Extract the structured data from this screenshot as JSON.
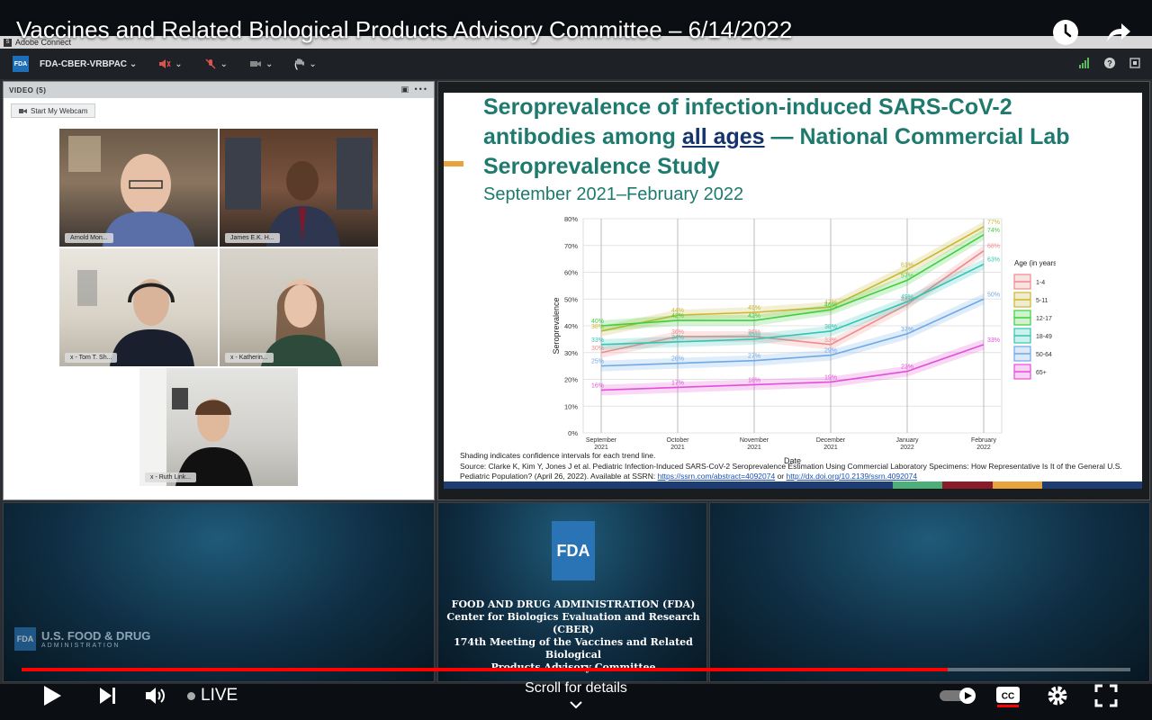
{
  "video": {
    "title": "Vaccines and Related Biological Products Advisory Committee – 6/14/2022",
    "live_label": "LIVE",
    "scroll_hint": "Scroll for details",
    "progress_fraction": 0.835
  },
  "window": {
    "app_title": "Adobe Connect"
  },
  "toolbar": {
    "badge": "FDA",
    "room_name": "FDA-CBER-VRBPAC"
  },
  "video_pod": {
    "header": "VIDEO (5)",
    "webcam_button": "Start My Webcam",
    "participants": [
      {
        "label": "Arnold Mon..."
      },
      {
        "label": "James E.K. H..."
      },
      {
        "label": "x - Tom T. Sh..."
      },
      {
        "label": "x - Katherin..."
      },
      {
        "label": "x - Ruth Link..."
      }
    ]
  },
  "slide": {
    "title_part1": "Seroprevalence of infection-induced SARS-CoV-2 antibodies among ",
    "title_emph": "all ages",
    "title_part2": " — National Commercial Lab Seroprevalence Study",
    "subtitle": "September 2021–February 2022",
    "note_shading": "Shading indicates confidence intervals for each trend line.",
    "note_source": "Source: Clarke K, Kim Y, Jones J et al.  Pediatric Infection-Induced SARS-CoV-2 Seroprevalence Estimation Using Commercial Laboratory Specimens: How Representative Is It of the General U.S. Pediatric Population? (April 26, 2022). Available at SSRN: ",
    "link1": "https://ssrn.com/abstract=4092074",
    "or": " or ",
    "link2": "http://dx.doi.org/10.2139/ssrn.4092074",
    "footer_colors": [
      "#1d3c73",
      "#1d3c73",
      "#1d3c73",
      "#1d3c73",
      "#1d3c73",
      "#1d3c73",
      "#1d3c73",
      "#1d3c73",
      "#1d3c73",
      "#4caf79",
      "#8b1a2b",
      "#e8a33d",
      "#1d3c73",
      "#1d3c73"
    ]
  },
  "chart_data": {
    "type": "line",
    "xlabel": "Date",
    "ylabel": "Seroprevalence",
    "legend_title": "Age (in years)",
    "categories": [
      "September\n2021",
      "October\n2021",
      "November\n2021",
      "December\n2021",
      "January\n2022",
      "February\n2022"
    ],
    "yticks": [
      "0%",
      "10%",
      "20%",
      "30%",
      "40%",
      "50%",
      "60%",
      "70%",
      "80%"
    ],
    "ylim": [
      0,
      80
    ],
    "series": [
      {
        "name": "1-4",
        "color": "#f08a8a",
        "values": [
          30,
          36,
          36,
          33,
          48,
          68
        ],
        "labels": [
          "30%",
          "36%",
          "36%",
          "33%",
          "48%",
          "68%"
        ]
      },
      {
        "name": "5-11",
        "color": "#c9b832",
        "values": [
          38,
          44,
          45,
          47,
          61,
          77
        ],
        "labels": [
          "38%",
          "44%",
          "45%",
          "47%",
          "61%",
          "77%"
        ]
      },
      {
        "name": "12-17",
        "color": "#3fcf3f",
        "values": [
          40,
          42,
          42,
          46,
          57,
          74
        ],
        "labels": [
          "40%",
          "42%",
          "42%",
          "46%",
          "57%",
          "74%"
        ]
      },
      {
        "name": "18-49",
        "color": "#33c4b4",
        "values": [
          33,
          34,
          35,
          38,
          49,
          63
        ],
        "labels": [
          "33%",
          "34%",
          "35%",
          "38%",
          "49%",
          "63%"
        ]
      },
      {
        "name": "50-64",
        "color": "#6fa8e6",
        "values": [
          25,
          26,
          27,
          29,
          37,
          50
        ],
        "labels": [
          "25%",
          "26%",
          "27%",
          "29%",
          "37%",
          "50%"
        ]
      },
      {
        "name": "65+",
        "color": "#e34fd8",
        "values": [
          16,
          17,
          18,
          19,
          23,
          33
        ],
        "labels": [
          "16%",
          "17%",
          "18%",
          "19%",
          "23%",
          "33%"
        ]
      }
    ]
  },
  "lower": {
    "fda_logo": "FDA",
    "info_lines": [
      "FOOD AND DRUG ADMINISTRATION (FDA)",
      "Center for Biologics Evaluation and Research (CBER)",
      "174th Meeting of the Vaccines and Related Biological",
      "Products Advisory Committee"
    ],
    "usfda_line1": "U.S. FOOD & DRUG",
    "usfda_line2": "ADMINISTRATION"
  },
  "icons": {
    "watch_later": "clock-icon",
    "share": "share-arrow-icon",
    "play": "play-icon",
    "next": "next-icon",
    "volume": "volume-icon",
    "captions": "cc-icon",
    "settings": "gear-icon",
    "fullscreen": "fullscreen-icon"
  }
}
